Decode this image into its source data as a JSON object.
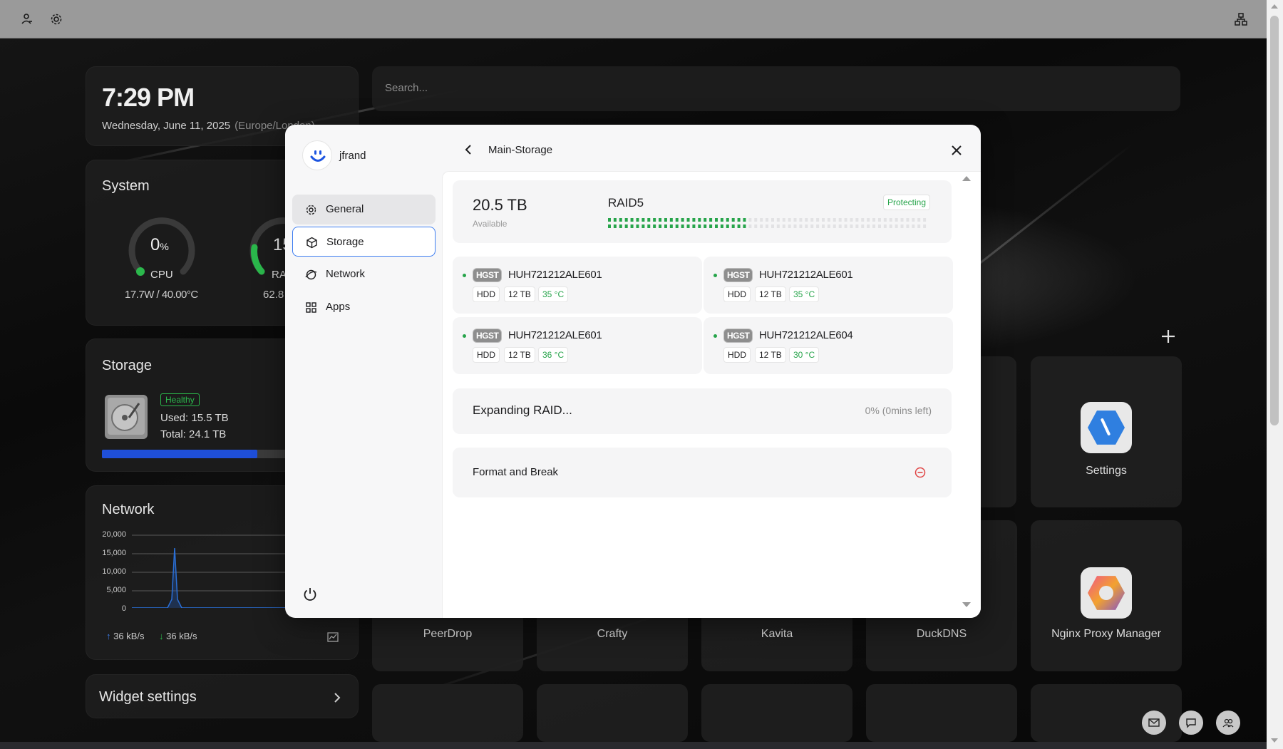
{
  "clock": {
    "time": "7:29 PM",
    "date": "Wednesday, June 11, 2025",
    "timezone": "(Europe/London)"
  },
  "search": {
    "placeholder": "Search..."
  },
  "system": {
    "title": "System",
    "cpu_value": "0",
    "cpu_unit": "%",
    "cpu_label": "CPU",
    "cpu_stats": "17.7W / 40.00°C",
    "cpu_percent": 0,
    "ram_value_partial": "15",
    "ram_label_partial": "RA",
    "ram_stats_partial": "62.8",
    "ram_percent": 15
  },
  "storage_widget": {
    "title": "Storage",
    "status": "Healthy",
    "used": "Used: 15.5 TB",
    "total": "Total: 24.1 TB",
    "used_fraction": 0.64
  },
  "network_widget": {
    "title": "Network",
    "y_ticks": [
      "20,000",
      "15,000",
      "10,000",
      "5,000",
      "0"
    ],
    "upload": "36 kB/s",
    "download": "36 kB/s"
  },
  "widget_settings": {
    "label": "Widget settings"
  },
  "apps": {
    "settings_label": "Settings",
    "bottom_row": [
      "PeerDrop",
      "Crafty",
      "Kavita",
      "DuckDNS",
      "Nginx Proxy Manager"
    ]
  },
  "modal": {
    "user": "jfrand",
    "nav": [
      "General",
      "Storage",
      "Network",
      "Apps"
    ],
    "active_nav": "Storage",
    "header_title": "Main-Storage",
    "capacity": "20.5 TB",
    "capacity_sub": "Available",
    "raid_level": "RAID5",
    "raid_status": "Protecting",
    "raid_progress": 0.43,
    "disks": [
      {
        "brand": "HGST",
        "model": "HUH721212ALE601",
        "type": "HDD",
        "size": "12 TB",
        "temp": "35 °C"
      },
      {
        "brand": "HGST",
        "model": "HUH721212ALE601",
        "type": "HDD",
        "size": "12 TB",
        "temp": "35 °C"
      },
      {
        "brand": "HGST",
        "model": "HUH721212ALE601",
        "type": "HDD",
        "size": "12 TB",
        "temp": "36 °C"
      },
      {
        "brand": "HGST",
        "model": "HUH721212ALE604",
        "type": "HDD",
        "size": "12 TB",
        "temp": "30 °C"
      }
    ],
    "expanding_label": "Expanding RAID...",
    "expanding_status": "0% (0mins left)",
    "format_label": "Format and Break"
  },
  "colors": {
    "accent_blue": "#3d7df1",
    "status_green": "#26a44a",
    "danger_red": "#e04545"
  }
}
